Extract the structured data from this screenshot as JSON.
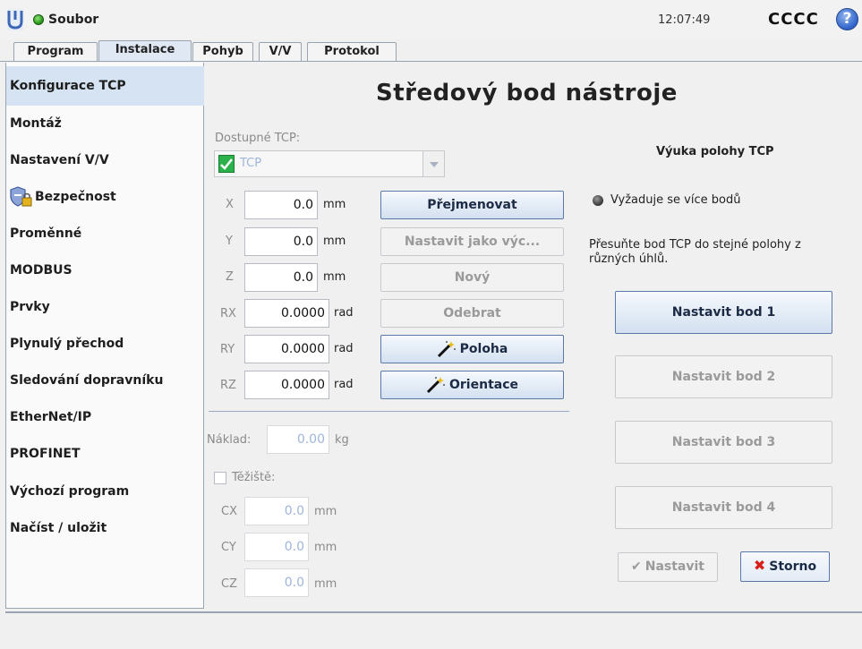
{
  "header": {
    "app_menu": "Soubor",
    "clock": "12:07:49",
    "robot_name": "CCCC",
    "help_label": "?"
  },
  "tabs": [
    "Program",
    "Instalace",
    "Pohyb",
    "V/V",
    "Protokol"
  ],
  "active_tab": "Instalace",
  "sidebar": {
    "items": [
      {
        "label": "Konfigurace TCP",
        "active": true
      },
      {
        "label": "Montáž"
      },
      {
        "label": "Nastavení V/V"
      },
      {
        "label": "Bezpečnost",
        "icon": "shield-lock-icon"
      },
      {
        "label": "Proměnné"
      },
      {
        "label": "MODBUS"
      },
      {
        "label": "Prvky"
      },
      {
        "label": "Plynulý přechod"
      },
      {
        "label": "Sledování dopravníku"
      },
      {
        "label": "EtherNet/IP"
      },
      {
        "label": "PROFINET"
      },
      {
        "label": "Výchozí program"
      },
      {
        "label": "Načíst / uložit"
      }
    ]
  },
  "main": {
    "title": "Středový bod nástroje",
    "available_tcp_label": "Dostupné TCP:",
    "selected_tcp": "TCP",
    "coords": [
      {
        "axis": "X",
        "value": "0.0",
        "unit": "mm"
      },
      {
        "axis": "Y",
        "value": "0.0",
        "unit": "mm"
      },
      {
        "axis": "Z",
        "value": "0.0",
        "unit": "mm"
      },
      {
        "axis": "RX",
        "value": "0.0000",
        "unit": "rad"
      },
      {
        "axis": "RY",
        "value": "0.0000",
        "unit": "rad"
      },
      {
        "axis": "RZ",
        "value": "0.0000",
        "unit": "rad"
      }
    ],
    "buttons": {
      "rename": "Přejmenovat",
      "set_default": "Nastavit jako výc...",
      "new": "Nový",
      "remove": "Odebrat",
      "position": "Poloha",
      "orientation": "Orientace"
    },
    "payload_label": "Náklad:",
    "payload_value": "0.00",
    "payload_unit": "kg",
    "cog_label": "Těžiště:",
    "cog": [
      {
        "axis": "CX",
        "value": "0.0",
        "unit": "mm"
      },
      {
        "axis": "CY",
        "value": "0.0",
        "unit": "mm"
      },
      {
        "axis": "CZ",
        "value": "0.0",
        "unit": "mm"
      }
    ]
  },
  "teach": {
    "title": "Výuka polohy TCP",
    "status": "Vyžaduje se více bodů",
    "instruction_line1": "Přesuňte bod TCP do stejné polohy z",
    "instruction_line2": "různých úhlů.",
    "set_points": [
      "Nastavit bod 1",
      "Nastavit bod 2",
      "Nastavit bod 3",
      "Nastavit bod 4"
    ],
    "apply": "Nastavit",
    "cancel": "Storno"
  },
  "colors": {
    "accent": "#d6e3f2",
    "status_ok": "#2c9d1c",
    "cancel_x": "#d8201a"
  }
}
